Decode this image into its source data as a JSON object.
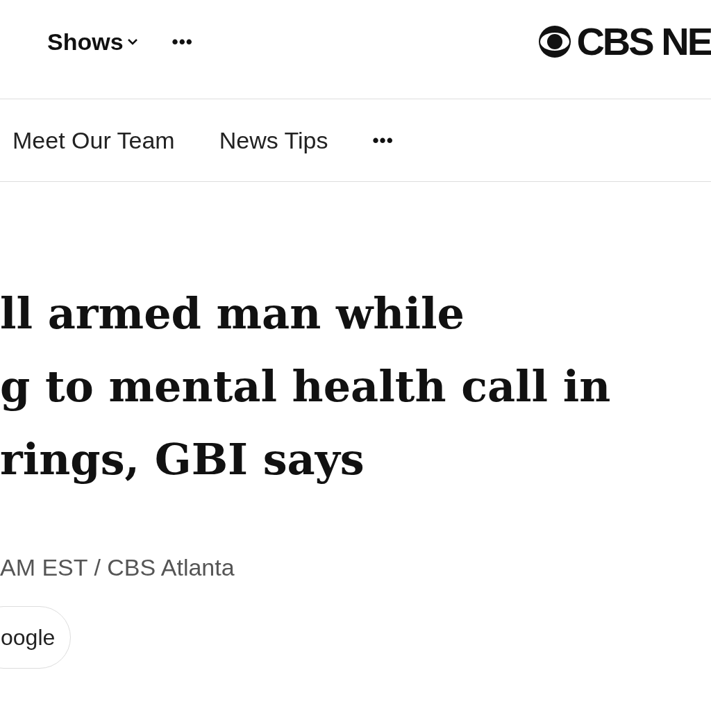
{
  "top_nav": {
    "items": [
      {
        "label": "Shows",
        "kind": "dropdown"
      },
      {
        "label": "•••",
        "kind": "more"
      }
    ],
    "logo": "CBS NE"
  },
  "section_nav": {
    "items": [
      {
        "label": "Meet Our Team",
        "kind": "link"
      },
      {
        "label": "News Tips",
        "kind": "link"
      },
      {
        "label": "•••",
        "kind": "more"
      }
    ]
  },
  "headline": [
    "ll armed man while",
    "g to mental health call in",
    "rings, GBI says"
  ],
  "byline": "AM EST / CBS Atlanta",
  "action_button": "oogle"
}
